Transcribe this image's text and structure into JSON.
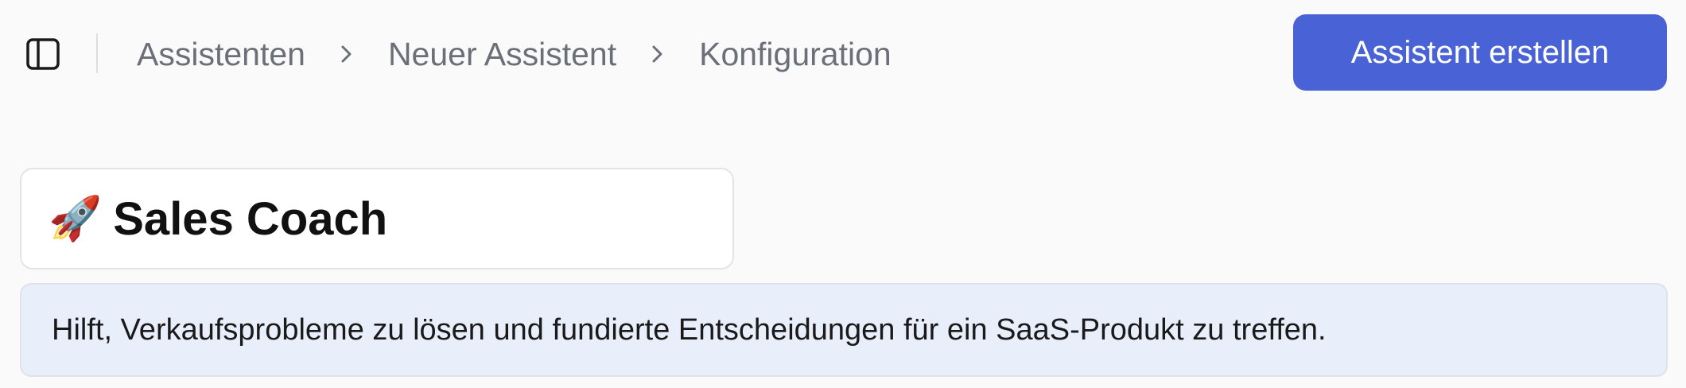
{
  "header": {
    "breadcrumb": [
      {
        "label": "Assistenten"
      },
      {
        "label": "Neuer Assistent"
      },
      {
        "label": "Konfiguration"
      }
    ],
    "create_button_label": "Assistent erstellen"
  },
  "assistant": {
    "emoji": "🚀",
    "name": "Sales Coach",
    "description": "Hilft, Verkaufsprobleme zu lösen und fundierte Entscheidungen für ein SaaS-Produkt zu treffen."
  },
  "icons": {
    "sidebar_toggle": "sidebar-panel-icon",
    "breadcrumb_separator": "chevron-right-icon"
  },
  "colors": {
    "accent": "#4963d6",
    "breadcrumb_text": "#6b6f78",
    "description_bg": "#e8eefa"
  }
}
